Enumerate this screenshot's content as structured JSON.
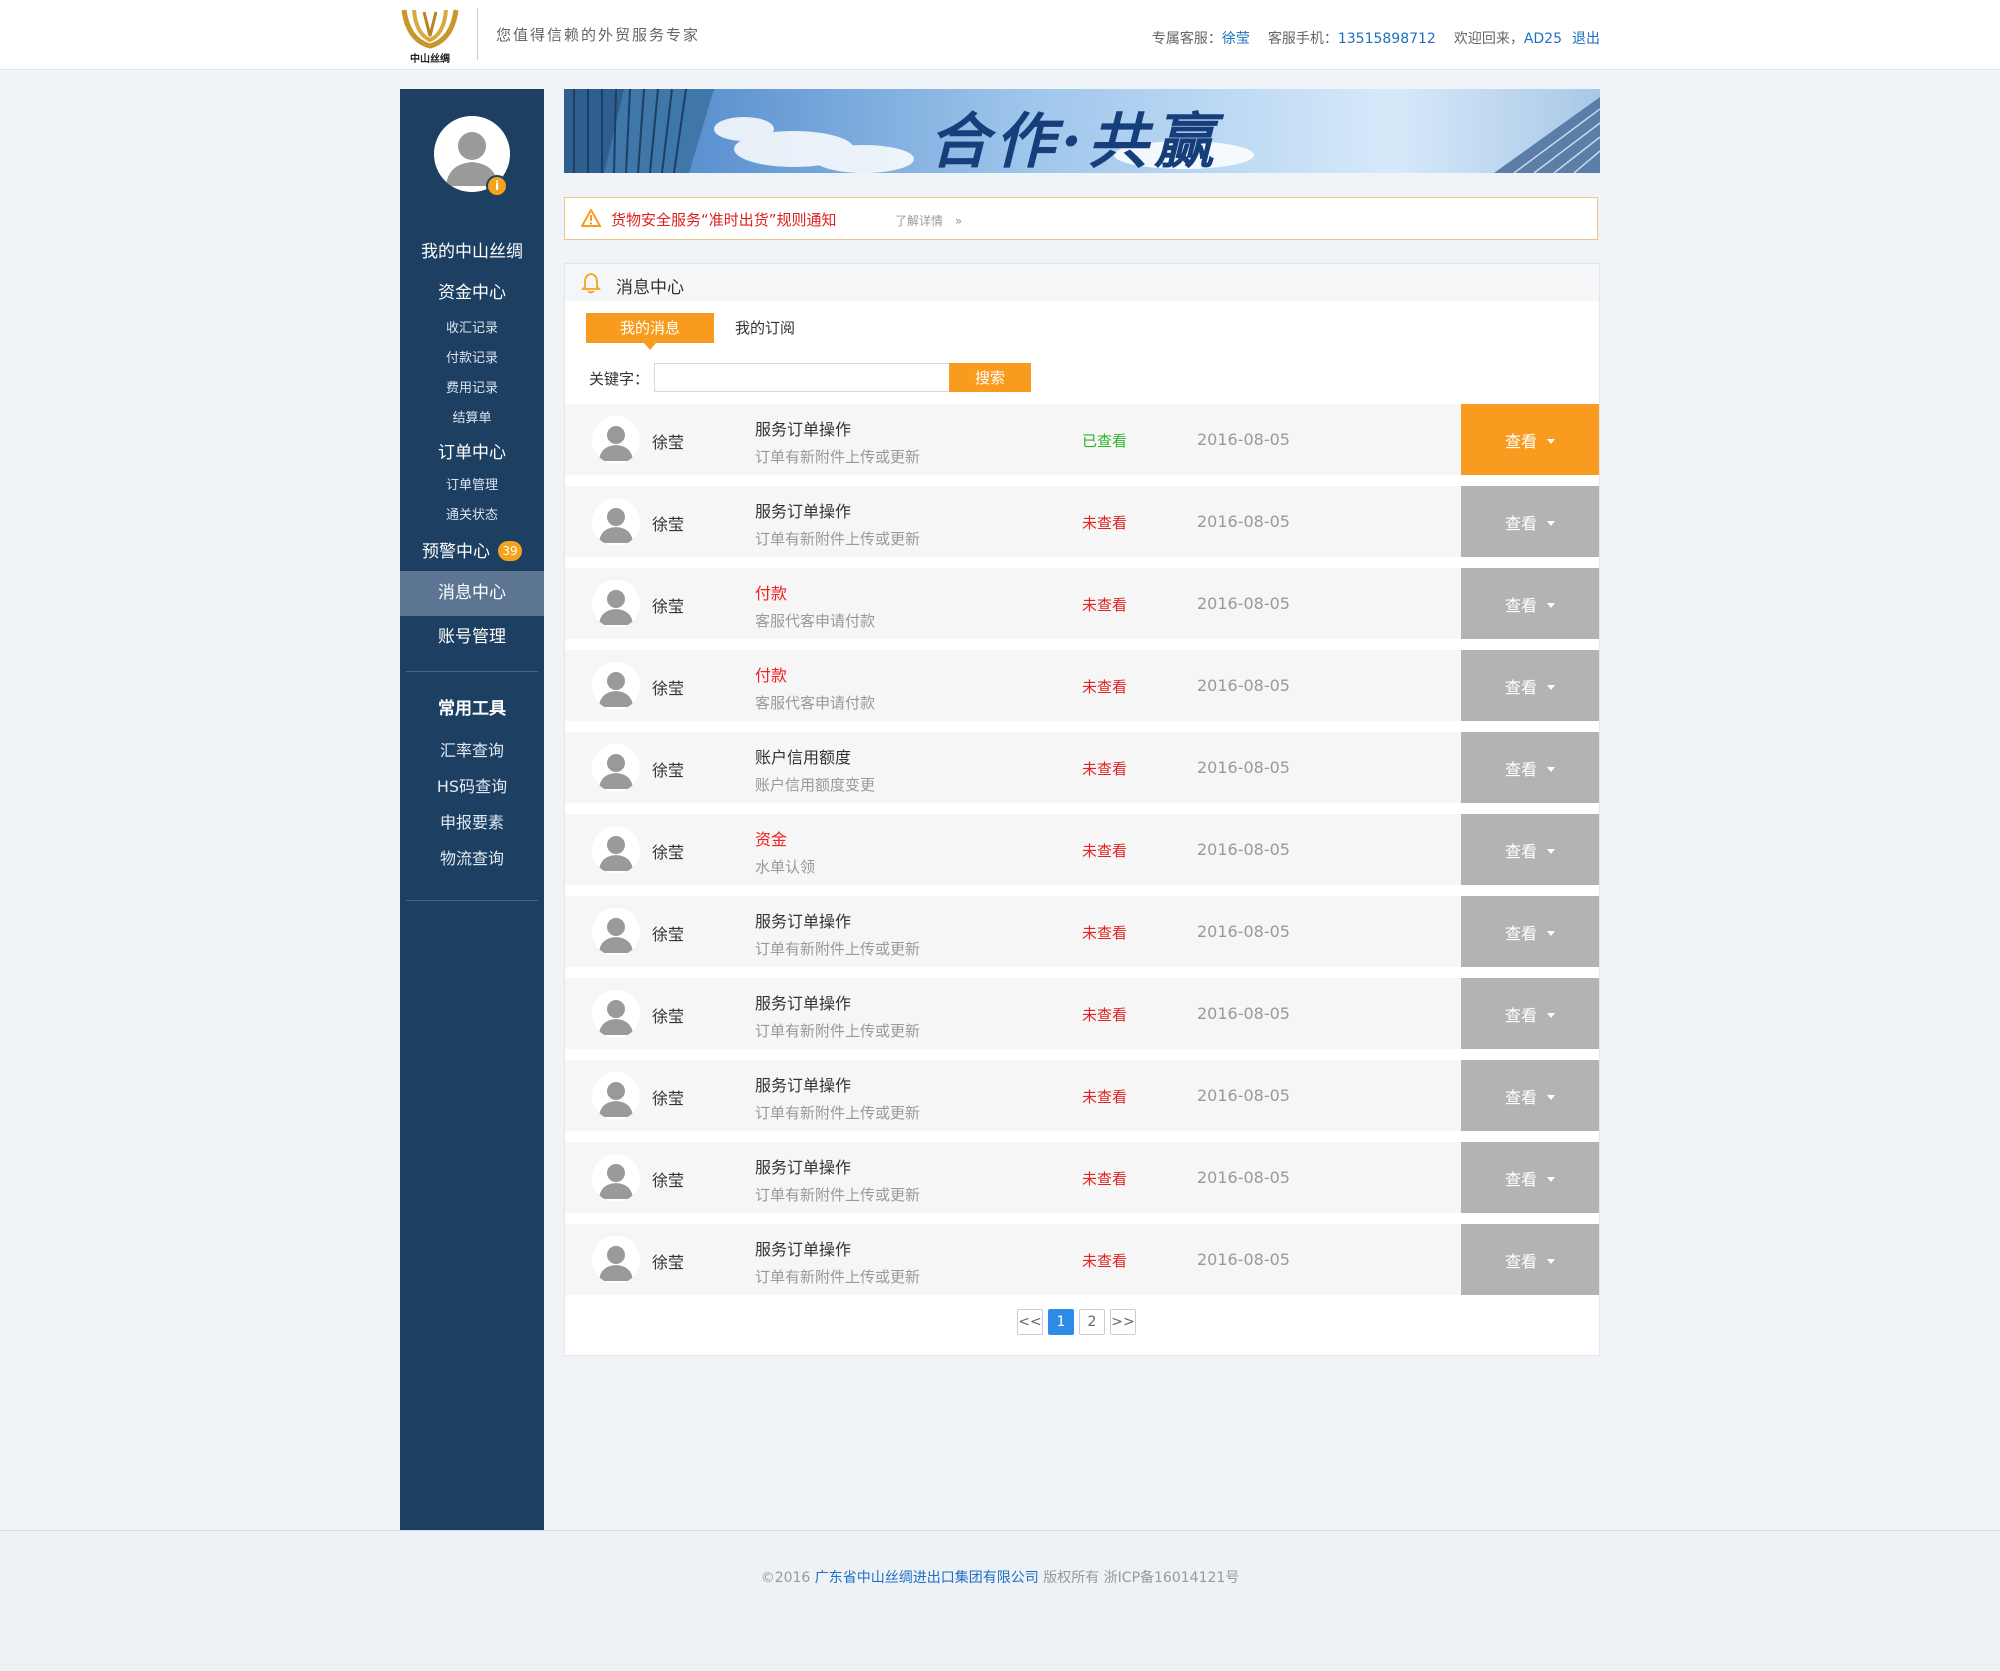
{
  "header": {
    "logo_text": "中山丝绸",
    "slogan": "您值得信赖的外贸服务专家",
    "service_label": "专属客服：",
    "service_name": "徐莹",
    "phone_label": "客服手机：",
    "phone": "13515898712",
    "welcome_label": "欢迎回来，",
    "username": "AD25",
    "logout": "退出"
  },
  "sidebar": {
    "avatar_badge": "i",
    "my_label": "我的中山丝绸",
    "funds_center": "资金中心",
    "funds_items": [
      "收汇记录",
      "付款记录",
      "费用记录",
      "结算单"
    ],
    "orders_center": "订单中心",
    "orders_items": [
      "订单管理",
      "通关状态"
    ],
    "alert_center": "预警中心",
    "alert_count": "39",
    "message_center": "消息中心",
    "account": "账号管理",
    "tools_title": "常用工具",
    "tools": [
      "汇率查询",
      "HS码查询",
      "申报要素",
      "物流查询"
    ]
  },
  "banner": {
    "text": "合作·共赢"
  },
  "notice": {
    "text": "货物安全服务“准时出货”规则通知",
    "more": "了解详情",
    "more_arrow": "»"
  },
  "panel": {
    "title": "消息中心",
    "tabs": [
      "我的消息",
      "我的订阅"
    ],
    "keyword_label": "关键字：",
    "keyword_value": "",
    "search_button": "搜索"
  },
  "messages": [
    {
      "name": "徐莹",
      "title": "服务订单操作",
      "title_red": false,
      "desc": "订单有新附件上传或更新",
      "status": "已查看",
      "read": true,
      "date": "2016-08-05",
      "action": "查看"
    },
    {
      "name": "徐莹",
      "title": "服务订单操作",
      "title_red": false,
      "desc": "订单有新附件上传或更新",
      "status": "未查看",
      "read": false,
      "date": "2016-08-05",
      "action": "查看"
    },
    {
      "name": "徐莹",
      "title": "付款",
      "title_red": true,
      "desc": "客服代客申请付款",
      "status": "未查看",
      "read": false,
      "date": "2016-08-05",
      "action": "查看"
    },
    {
      "name": "徐莹",
      "title": "付款",
      "title_red": true,
      "desc": "客服代客申请付款",
      "status": "未查看",
      "read": false,
      "date": "2016-08-05",
      "action": "查看"
    },
    {
      "name": "徐莹",
      "title": "账户信用额度",
      "title_red": false,
      "desc": "账户信用额度变更",
      "status": "未查看",
      "read": false,
      "date": "2016-08-05",
      "action": "查看"
    },
    {
      "name": "徐莹",
      "title": "资金",
      "title_red": true,
      "desc": "水单认领",
      "status": "未查看",
      "read": false,
      "date": "2016-08-05",
      "action": "查看"
    },
    {
      "name": "徐莹",
      "title": "服务订单操作",
      "title_red": false,
      "desc": "订单有新附件上传或更新",
      "status": "未查看",
      "read": false,
      "date": "2016-08-05",
      "action": "查看"
    },
    {
      "name": "徐莹",
      "title": "服务订单操作",
      "title_red": false,
      "desc": "订单有新附件上传或更新",
      "status": "未查看",
      "read": false,
      "date": "2016-08-05",
      "action": "查看"
    },
    {
      "name": "徐莹",
      "title": "服务订单操作",
      "title_red": false,
      "desc": "订单有新附件上传或更新",
      "status": "未查看",
      "read": false,
      "date": "2016-08-05",
      "action": "查看"
    },
    {
      "name": "徐莹",
      "title": "服务订单操作",
      "title_red": false,
      "desc": "订单有新附件上传或更新",
      "status": "未查看",
      "read": false,
      "date": "2016-08-05",
      "action": "查看"
    },
    {
      "name": "徐莹",
      "title": "服务订单操作",
      "title_red": false,
      "desc": "订单有新附件上传或更新",
      "status": "未查看",
      "read": false,
      "date": "2016-08-05",
      "action": "查看"
    }
  ],
  "pagination": {
    "prev": "<<",
    "pages": [
      "1",
      "2"
    ],
    "current": "1",
    "next": ">>"
  },
  "footer": {
    "prefix": "©2016 ",
    "company": "广东省中山丝绸进出口集团有限公司",
    "suffix": " 版权所有 浙ICP备16014121号"
  },
  "colors": {
    "sidebar_bg": "#1d3f62",
    "accent_orange": "#f89b1e",
    "read_green": "#2bb52b",
    "unread_red": "#e22222",
    "button_gray": "#b3b3b3",
    "link_blue": "#1f6fc1"
  }
}
